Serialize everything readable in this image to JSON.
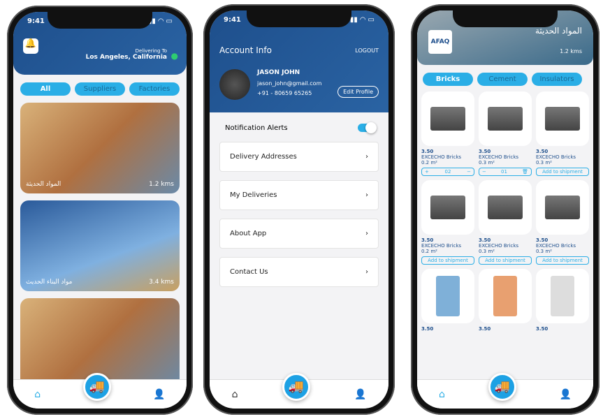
{
  "status_time": "9:41",
  "home": {
    "delivering_to": "Delivering To",
    "location": "Los Angeles, California",
    "filters": [
      "All",
      "Suppliers",
      "Factories"
    ],
    "cards": [
      {
        "name": "المواد الحديثة",
        "distance": "1.2 kms"
      },
      {
        "name": "مواد البناء الحديث",
        "distance": "3.4 kms"
      },
      {
        "name": "",
        "distance": ""
      }
    ]
  },
  "account": {
    "title": "Account Info",
    "logout": "LOGOUT",
    "name": "JASON JOHN",
    "email": "jason_john@gmail.com",
    "phone": "+91  -  80659 65265",
    "edit_profile": "Edit Profile",
    "notification_alerts": "Notification Alerts",
    "notifications_on": true,
    "menu": [
      "Delivery Addresses",
      "My Deliveries",
      "About App",
      "Contact Us"
    ]
  },
  "store": {
    "name": "المواد الحديثة",
    "distance": "1.2 kms",
    "logo": "AFAQ",
    "categories": [
      "Bricks",
      "Cement",
      "Insulators"
    ],
    "products": [
      {
        "price": "3.50",
        "name": "EXCECHO Bricks",
        "size": "0.2 m²",
        "qty": "02",
        "action": "stepper"
      },
      {
        "price": "3.50",
        "name": "EXCECHO Bricks",
        "size": "0.3 m²",
        "qty": "01",
        "action": "stepper-delete"
      },
      {
        "price": "3.50",
        "name": "EXCECHO Bricks",
        "size": "0.3 m²",
        "action": "Add to shipment"
      },
      {
        "price": "3.50",
        "name": "EXCECHO Bricks",
        "size": "0.2 m²",
        "action": "Add to shipment"
      },
      {
        "price": "3.50",
        "name": "EXCECHO Bricks",
        "size": "0.3 m²",
        "action": "Add to shipment"
      },
      {
        "price": "3.50",
        "name": "EXCECHO Bricks",
        "size": "0.3 m²",
        "action": "Add to shipment"
      },
      {
        "price": "3.50",
        "name": "",
        "size": "",
        "action": ""
      },
      {
        "price": "3.50",
        "name": "",
        "size": "",
        "action": ""
      },
      {
        "price": "3.50",
        "name": "",
        "size": "",
        "action": ""
      }
    ]
  },
  "colors": {
    "primary": "#1e4f8c",
    "accent": "#2aaee6",
    "location_pin": "#2ecc71"
  }
}
